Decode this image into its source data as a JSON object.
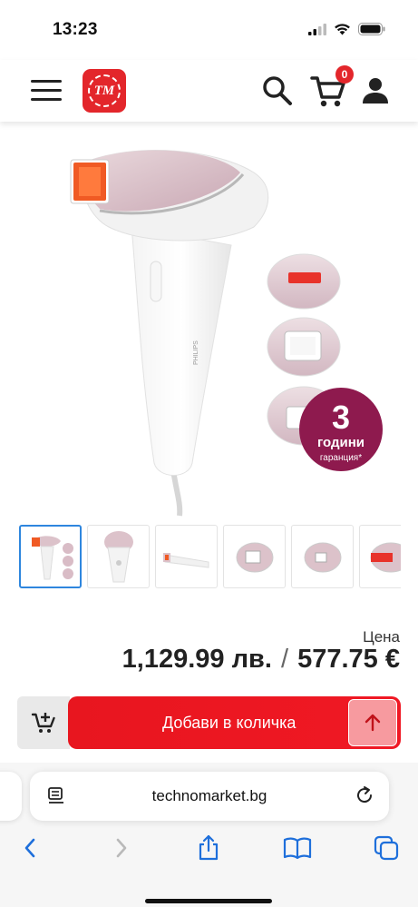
{
  "status_bar": {
    "time": "13:23"
  },
  "header": {
    "logo_text": "TM",
    "cart_count": "0",
    "icons": [
      "menu-icon",
      "search-icon",
      "cart-icon",
      "user-icon"
    ]
  },
  "product": {
    "brand_on_device": "PHILIPS",
    "warranty_badge": {
      "number": "3",
      "line1": "години",
      "line2": "гаранция*"
    },
    "thumbnails_count": 6,
    "active_thumbnail": 1
  },
  "price": {
    "label": "Цена",
    "bgn": "1,129.99 лв.",
    "separator": "/",
    "eur": "577.75 €"
  },
  "actions": {
    "add_label": "Добави в количка"
  },
  "browser": {
    "url": "technomarket.bg"
  },
  "colors": {
    "brand_red": "#e3262b",
    "button_red": "#ec1720",
    "ios_blue": "#1e6fdb",
    "badge_purple": "#8e1a4e"
  }
}
